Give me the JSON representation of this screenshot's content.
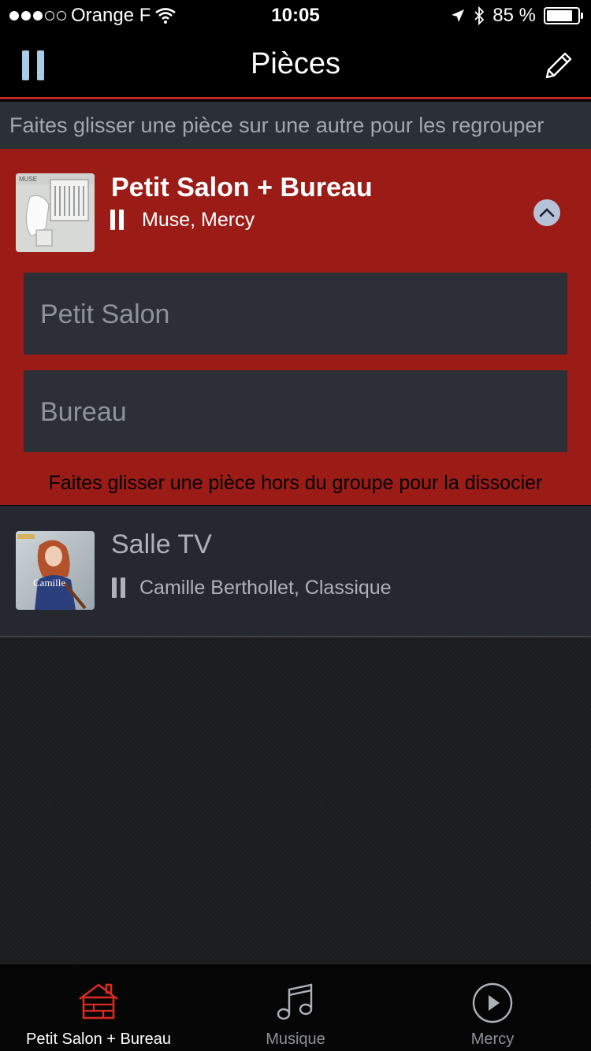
{
  "status_bar": {
    "carrier": "Orange F",
    "time": "10:05",
    "battery_text": "85 %",
    "battery_level": 0.85,
    "signal_bars_filled": 3,
    "signal_bars_total": 5,
    "icons": [
      "wifi-icon",
      "location-icon",
      "bluetooth-icon",
      "battery-icon"
    ]
  },
  "nav": {
    "title": "Pièces",
    "left_icon": "pause-icon",
    "right_icon": "pencil-icon"
  },
  "hints": {
    "top": "Faites glisser une pièce sur une autre pour les regrouper",
    "group_bottom": "Faites glisser une pièce hors du groupe pour la dissocier"
  },
  "group": {
    "title": "Petit Salon + Bureau",
    "now_playing": "Muse, Mercy",
    "state_icon": "pause-icon",
    "collapse_icon": "chevron-up-icon",
    "members": [
      {
        "label": "Petit Salon"
      },
      {
        "label": "Bureau"
      }
    ]
  },
  "rooms": [
    {
      "title": "Salle TV",
      "now_playing": "Camille Berthollet, Classique",
      "state_icon": "pause-icon",
      "album_text": "Camille"
    }
  ],
  "tabbar": {
    "tabs": [
      {
        "label": "Petit Salon + Bureau",
        "icon": "house-icon",
        "active": true
      },
      {
        "label": "Musique",
        "icon": "music-note-icon",
        "active": false
      },
      {
        "label": "Mercy",
        "icon": "play-circle-icon",
        "active": false
      }
    ]
  },
  "colors": {
    "accent_red": "#c2251f",
    "group_background": "#9b1c17",
    "nav_pause_blue": "#a9cbe6"
  }
}
